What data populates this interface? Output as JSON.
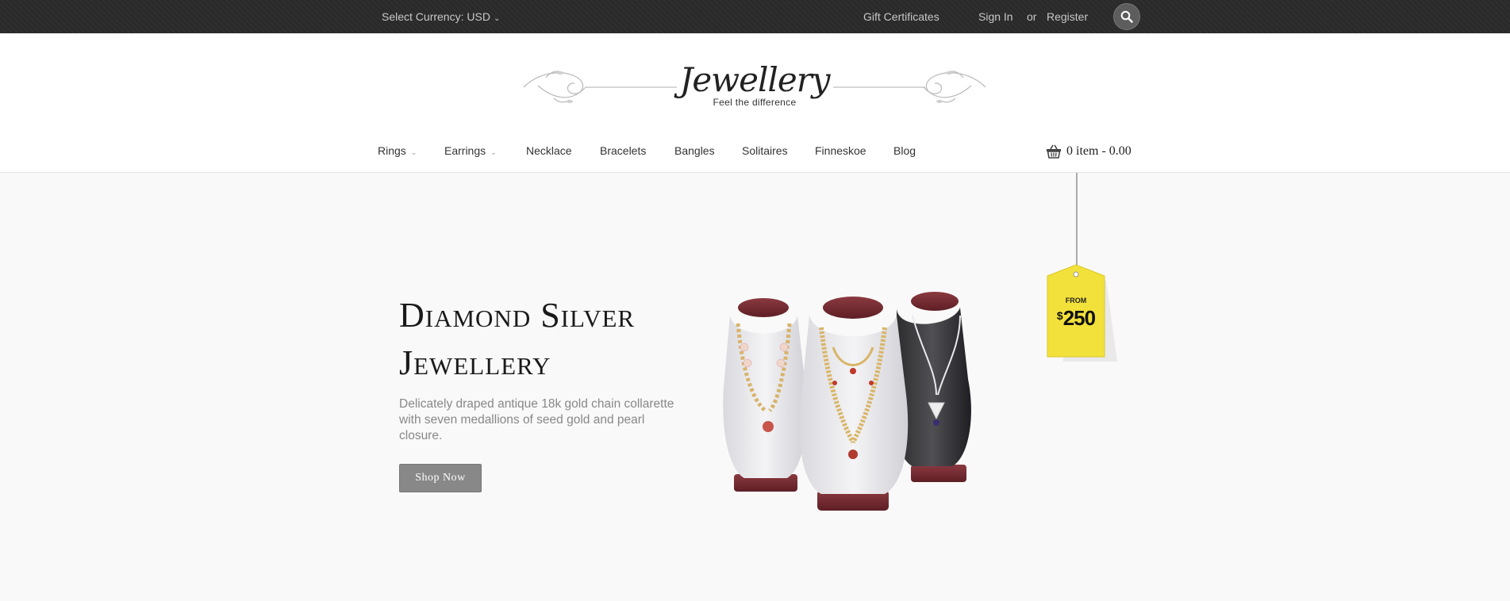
{
  "topbar": {
    "currency_label": "Select Currency: USD",
    "gift_certificates": "Gift Certificates",
    "sign_in": "Sign In",
    "or": "or",
    "register": "Register",
    "search_icon": "search-icon"
  },
  "logo": {
    "title": "Jewellery",
    "tagline": "Feel the difference"
  },
  "nav": {
    "items": [
      {
        "label": "Rings",
        "dropdown": true
      },
      {
        "label": "Earrings",
        "dropdown": true
      },
      {
        "label": "Necklace",
        "dropdown": false
      },
      {
        "label": "Bracelets",
        "dropdown": false
      },
      {
        "label": "Bangles",
        "dropdown": false
      },
      {
        "label": "Solitaires",
        "dropdown": false
      },
      {
        "label": "Finneskoe",
        "dropdown": false
      },
      {
        "label": "Blog",
        "dropdown": false
      }
    ],
    "cart": {
      "label": "0 item - 0.00",
      "icon": "basket-icon"
    }
  },
  "hero": {
    "title_line1": "Diamond Silver",
    "title_line2": "Jewellery",
    "description": "Delicately draped antique 18k gold chain collarette with seven medallions of seed gold and pearl closure.",
    "button_label": "Shop Now",
    "price_tag": {
      "from": "FROM",
      "currency": "$",
      "amount": "250"
    }
  },
  "colors": {
    "topbar_bg": "#2a2a2a",
    "hero_bg": "#f9f9f9",
    "button_bg": "#888888",
    "tag_yellow": "#f2e13a"
  }
}
